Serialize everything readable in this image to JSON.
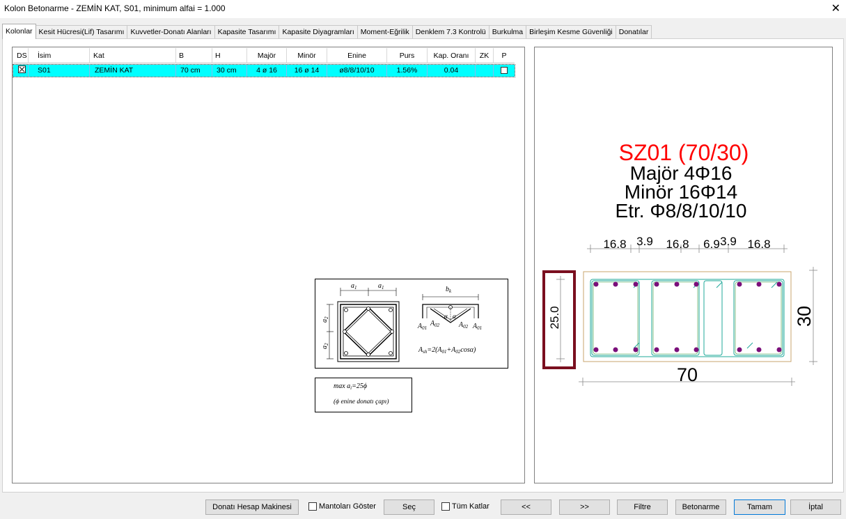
{
  "window": {
    "title": "Kolon Betonarme - ZEMİN KAT, S01, minimum alfai = 1.000",
    "close_glyph": "✕"
  },
  "tabs": [
    "Kolonlar",
    "Kesit Hücresi(Lif) Tasarımı",
    "Kuvvetler-Donatı Alanları",
    "Kapasite Tasarımı",
    "Kapasite Diyagramları",
    "Moment-Eğrilik",
    "Denklem 7.3 Kontrolü",
    "Burkulma",
    "Birleşim Kesme Güvenliği",
    "Donatılar"
  ],
  "grid": {
    "headers": [
      "DS",
      "İsim",
      "Kat",
      "B",
      "H",
      "Majör",
      "Minör",
      "Enine",
      "Purs",
      "Kap. Oranı",
      "ZK",
      "P"
    ],
    "row": {
      "ds_checked": true,
      "isim": "S01",
      "kat": "ZEMİN KAT",
      "b": "70 cm",
      "h": "30 cm",
      "major": "4 ø 16",
      "minor": "16 ø 14",
      "enine": "ø8/8/10/10",
      "purs": "1.56%",
      "kap_orani": "0.04",
      "zk": "",
      "p_checked": false
    }
  },
  "diagram": {
    "a1": "a",
    "a1_sub": "1",
    "a2": "a",
    "a2_sub": "2",
    "bk": "b",
    "bk_sub": "k",
    "alpha": "α",
    "a01": "A",
    "a01_sub": "01",
    "a02": "A",
    "a02_sub": "02",
    "formula": "A",
    "formula_sub": "sh",
    "formula_rest": "=2(A",
    "formula_01": "01",
    "formula_plus": "+A",
    "formula_02": "02",
    "formula_end": "cosα)",
    "max_text": "max a",
    "max_sub": "i",
    "max_rest": "=25ϕ",
    "note": "(ϕ enine donatı çapı)"
  },
  "section": {
    "name": "SZ01 (70/30)",
    "major": "Majör 4Φ16",
    "minor": "Minör 16Φ14",
    "etr": "Etr. Φ8/8/10/10",
    "dims_top": [
      "16.8",
      "3.9",
      "16.8",
      "6.9",
      "3.9",
      "16.8"
    ],
    "dim_left": "25.0",
    "dim_right": "30",
    "dim_bottom": "70",
    "colors": {
      "title": "#ff0000",
      "bar": "#7a0f7a",
      "stirrup": "#1fa89a",
      "outline": "#c8a46e",
      "highlight": "#7a0f1f"
    }
  },
  "buttons": {
    "donati": "Donatı Hesap Makinesi",
    "mantolari": "Mantoları Göster",
    "sec": "Seç",
    "tum_katlar": "Tüm Katlar",
    "prev": "<<",
    "next": ">>",
    "filtre": "Filtre",
    "betonarme": "Betonarme",
    "tamam": "Tamam",
    "iptal": "İptal"
  }
}
